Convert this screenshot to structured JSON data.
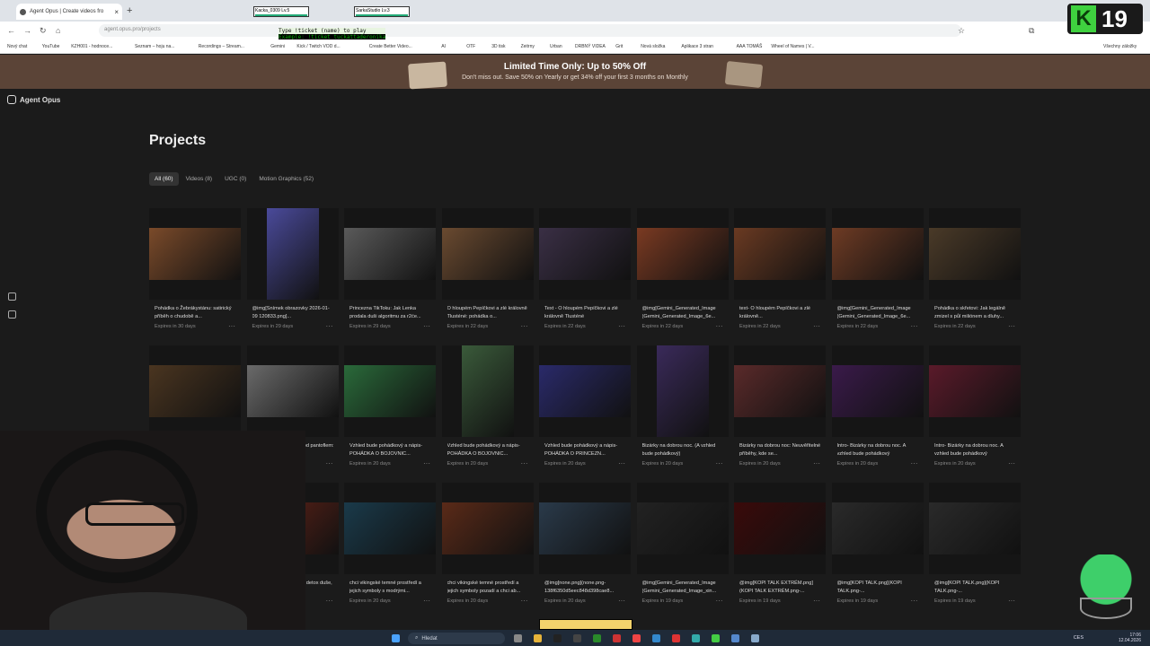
{
  "browser": {
    "tab_title": "Agent Opus | Create videos fro",
    "url": "agent.opus.pro/projects",
    "streams": [
      {
        "name": "Kacka_0309 Lv.5"
      },
      {
        "name": "SarkaStudio Lv.3"
      }
    ],
    "overlay_lines": [
      "Type !ticket (name) to play",
      "Example: !ticket tuckattaderonika"
    ],
    "bookmarks": [
      "Nový chat",
      "YouTube",
      "KZH001 - hodnoce...",
      "Seznam – hoju na...",
      "Recordings – Stream...",
      "Gemini",
      "Kick / Twitch VOD d...",
      "Create Better Video...",
      "AI",
      "OTF",
      "3D tisk",
      "Zeitrny",
      "Urban",
      "DRBNÝ VIDEA",
      "Grit",
      "Nová složka",
      "Aplikace 3 stran",
      "AAA TOMÁŠ",
      "Wheel of Names | V...",
      "Všechny záložky"
    ],
    "k_badge": "19"
  },
  "promo": {
    "title": "Limited Time Only: Up to 50% Off",
    "subtitle": "Don't miss out. Save 50% on Yearly or get 34% off your first 3 months on Monthly"
  },
  "app": {
    "brand": "Agent Opus"
  },
  "page": {
    "title": "Projects",
    "filters": [
      {
        "label": "All (60)",
        "active": true
      },
      {
        "label": "Videos (8)",
        "active": false
      },
      {
        "label": "UGC (0)",
        "active": false
      },
      {
        "label": "Motion Graphics (52)",
        "active": false
      }
    ]
  },
  "projects": [
    {
      "title": "Pohádka o Žebrákystánu: satirický příběh o chudobě a...",
      "expires": "Expires in 30 days",
      "c": "#7a4a2a",
      "v": false
    },
    {
      "title": "@img[Snímek obrazovky 2026-01-09 120833.png]...",
      "expires": "Expires in 29 days",
      "c": "#4a4a9a",
      "v": true
    },
    {
      "title": "Princezna TikToku: Jak Lenka prodala duši algoritmu za r2će...",
      "expires": "Expires in 29 days",
      "c": "#5a5a5a",
      "v": false
    },
    {
      "title": "O hloupém Pepíčkovi a zlé královně Tlusténé: pohádka o...",
      "expires": "Expires in 22 days",
      "c": "#6a4a30",
      "v": false
    },
    {
      "title": "Text - O hloupém Pepíčkovi a zlé královně Tlusténé",
      "expires": "Expires in 22 days",
      "c": "#3a2f45",
      "v": false
    },
    {
      "title": "@img[Gemini_Generated_Image (Gemini_Generated_Image_6e...",
      "expires": "Expires in 22 days",
      "c": "#7a3a22",
      "v": false
    },
    {
      "title": "text- O hloupém Pepíčkovi a zlé královně...",
      "expires": "Expires in 22 days",
      "c": "#6a3a22",
      "v": false
    },
    {
      "title": "@img[Gemini_Generated_Image (Gemini_Generated_Image_6e...",
      "expires": "Expires in 22 days",
      "c": "#6e3b24",
      "v": false
    },
    {
      "title": "Pohádka o skřetovi: Jak legálně zmizel s půl miliónem a dluhy...",
      "expires": "Expires in 22 days",
      "c": "#4a3a28",
      "v": false
    },
    {
      "title": "Pohádka o Pepíčkovi pod pantoflem: vězení bez mříží v...",
      "expires": "Expires in 22 days",
      "c": "#4a3520",
      "v": false
    },
    {
      "title": "Pohádka o Pepíčkovi pod pantoflem: královna Tlusténa...",
      "expires": "Expires in 21 days",
      "c": "#6a6a6a",
      "v": false
    },
    {
      "title": "Vzhled bude pohádkový a nápis- POHÁDKA O BOJOVNIC...",
      "expires": "Expires in 20 days",
      "c": "#2a6a3a",
      "v": false
    },
    {
      "title": "Vzhled bude pohádkový a nápis- POHÁDKA O BOJOVNIC...",
      "expires": "Expires in 20 days",
      "c": "#3a5a3a",
      "v": true
    },
    {
      "title": "Vzhled bude pohádkový a nápis- POHÁDKA O PRINCEZN...",
      "expires": "Expires in 20 days",
      "c": "#2a2a6a",
      "v": false
    },
    {
      "title": "Bizárky na dobrou noc. (A vzhled bude pohádkový)",
      "expires": "Expires in 20 days",
      "c": "#3a2a5a",
      "v": true
    },
    {
      "title": "Bizárky na dobrou noc: Neuvěřitelné příběhy, kde se...",
      "expires": "Expires in 20 days",
      "c": "#5a2a2a",
      "v": false
    },
    {
      "title": "Intro- Bizárky na dobrou noc. A vzhled bude pohádkový",
      "expires": "Expires in 20 days",
      "c": "#3a1a4a",
      "v": false
    },
    {
      "title": "Intro- Bizárky na dobrou noc. A vzhled bude pohádkový",
      "expires": "Expires in 20 days",
      "c": "#5a1a2a",
      "v": false
    },
    {
      "title": "",
      "expires": "",
      "c": "#6a1a1a",
      "v": false
    },
    {
      "title": "Dvojí život influencerky: detox duše, prasečí hlava a trapas...",
      "expires": "Expires in 20 days",
      "c": "#6a2418",
      "v": false
    },
    {
      "title": "chci vikingské temné prostředí a jejich symboly s modrými...",
      "expires": "Expires in 20 days",
      "c": "#1a3a4a",
      "v": false
    },
    {
      "title": "chci vikingské temné prostředí a jejich symboly pozadí a chci ab...",
      "expires": "Expires in 20 days",
      "c": "#5a2a18",
      "v": false
    },
    {
      "title": "@img[none.png](none.png-138f6350d5eec848d398cae8...",
      "expires": "Expires in 20 days",
      "c": "#2a3a4a",
      "v": false
    },
    {
      "title": "@img[Gemini_Generated_Image (Gemini_Generated_Image_xin...",
      "expires": "Expires in 19 days",
      "c": "#222222",
      "v": false
    },
    {
      "title": "@img[KOPI TALK EXTRÉM.png] (KOPI TALK EXTRÉM.png-...",
      "expires": "Expires in 19 days",
      "c": "#3a0a0a",
      "v": false
    },
    {
      "title": "@img[KOPI TALK.png](KOPI TALK.png-...",
      "expires": "Expires in 19 days",
      "c": "#2a2a2a",
      "v": false
    },
    {
      "title": "@img[KOPI TALK.png](KOPI TALK.png-...",
      "expires": "Expires in 19 days",
      "c": "#2a2a2a",
      "v": false
    }
  ],
  "taskbar": {
    "search_placeholder": "Hledat",
    "lang": "CES",
    "time": "17:06",
    "date": "12.04.2026"
  },
  "icons": [
    "back-icon",
    "forward-icon",
    "reload-icon",
    "home-icon",
    "star-icon",
    "extensions-icon",
    "home-nav-icon",
    "projects-nav-icon",
    "search-icon",
    "windows-start-icon"
  ]
}
